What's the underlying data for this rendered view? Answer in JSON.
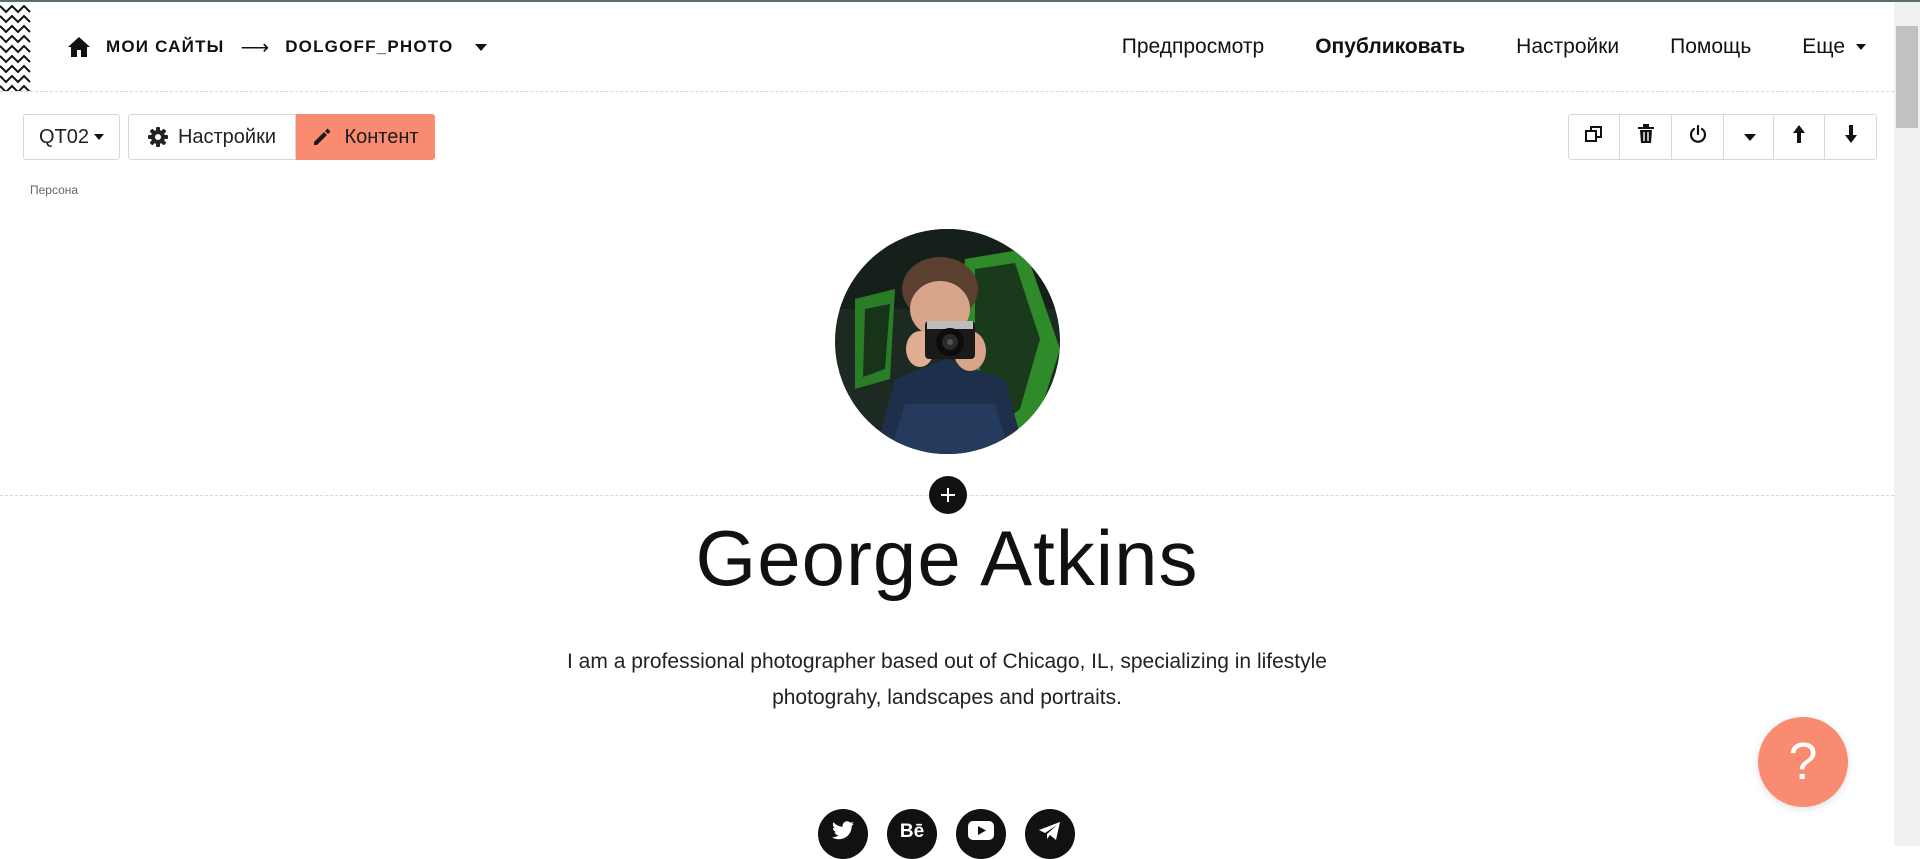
{
  "header": {
    "breadcrumb": {
      "home_icon": "home-icon",
      "my_sites": "Мои сайты",
      "arrow": "⟶",
      "site_name": "dolgoff_photo"
    },
    "nav": {
      "preview": "Предпросмотр",
      "publish": "Опубликовать",
      "settings": "Настройки",
      "help": "Помощь",
      "more": "Еще"
    }
  },
  "toolbar": {
    "block_code": "QT02",
    "settings_label": "Настройки",
    "content_label": "Контент",
    "block_type": "Персона",
    "icons": [
      "duplicate-icon",
      "trash-icon",
      "power-icon",
      "caret-down-icon",
      "arrow-up-icon",
      "arrow-down-icon"
    ],
    "accent_color": "#f98c70"
  },
  "content": {
    "name": "George Atkins",
    "bio_line1": "I am a professional photographer based out of Chicago, IL, specializing in lifestyle",
    "bio_line2": "photograhy, landscapes and portraits.",
    "add_label": "+",
    "socials": [
      {
        "icon": "twitter-icon"
      },
      {
        "icon": "behance-icon",
        "text": "Bē"
      },
      {
        "icon": "youtube-icon"
      },
      {
        "icon": "telegram-icon"
      }
    ]
  },
  "help_fab": "?"
}
